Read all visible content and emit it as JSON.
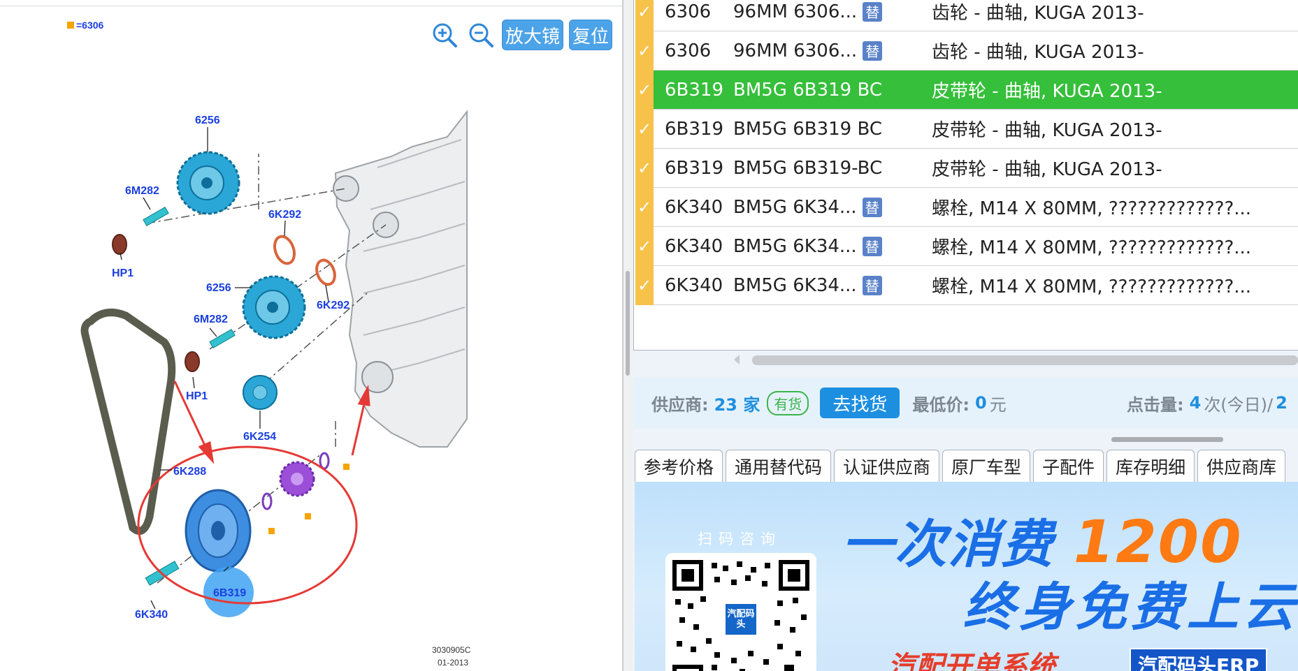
{
  "diagram": {
    "legend_text": "=6306",
    "toolbar": {
      "zoom_in_icon": "zoom-in-icon",
      "zoom_out_icon": "zoom-out-icon",
      "magnifier_label": "放大镜",
      "reset_label": "复位"
    },
    "labels": {
      "cam_gear_top": "6256",
      "bolt_top": "6M282",
      "seal_top": "6K292",
      "washer_top": "HP1",
      "cam_gear_mid": "6256",
      "seal_mid": "6K292",
      "bolt_mid": "6M282",
      "washer_mid": "HP1",
      "tensioner": "6K254",
      "belt": "6K288",
      "pulley": "6B319",
      "crank_bolt": "6K340"
    },
    "stamp_code": "3030905C",
    "stamp_date": "01-2013"
  },
  "parts_table": {
    "rows": [
      {
        "code": "6306",
        "part_no": "96MM 6306...",
        "substitute": "替",
        "desc": "齿轮 - 曲轴, KUGA 2013-",
        "selected": false
      },
      {
        "code": "6306",
        "part_no": "96MM 6306...",
        "substitute": "替",
        "desc": "齿轮 - 曲轴, KUGA 2013-",
        "selected": false
      },
      {
        "code": "6B319",
        "part_no": "BM5G 6B319 BC",
        "substitute": "",
        "desc": "皮带轮 - 曲轴, KUGA 2013-",
        "selected": true
      },
      {
        "code": "6B319",
        "part_no": "BM5G 6B319 BC",
        "substitute": "",
        "desc": "皮带轮 - 曲轴, KUGA 2013-",
        "selected": false
      },
      {
        "code": "6B319",
        "part_no": "BM5G 6B319-BC",
        "substitute": "",
        "desc": "皮带轮 - 曲轴, KUGA 2013-",
        "selected": false
      },
      {
        "code": "6K340",
        "part_no": "BM5G 6K34...",
        "substitute": "替",
        "desc": "螺栓, M14 X 80MM, ?????????????...",
        "selected": false
      },
      {
        "code": "6K340",
        "part_no": "BM5G 6K34...",
        "substitute": "替",
        "desc": "螺栓, M14 X 80MM, ?????????????...",
        "selected": false
      },
      {
        "code": "6K340",
        "part_no": "BM5G 6K34...",
        "substitute": "替",
        "desc": "螺栓, M14 X 80MM, ?????????????...",
        "selected": false
      }
    ]
  },
  "supplier_bar": {
    "supplier_label": "供应商:",
    "supplier_count": "23 家",
    "stock_badge": "有货",
    "find_button": "去找货",
    "min_price_label": "最低价:",
    "min_price_value": "0",
    "min_price_unit": "元",
    "clicks_label": "点击量:",
    "clicks_today": "4",
    "clicks_today_suffix": "次(今日)/",
    "clicks_total_partial": "2"
  },
  "tabs": [
    "参考价格",
    "通用替代码",
    "认证供应商",
    "原厂车型",
    "子配件",
    "库存明细",
    "供应商库"
  ],
  "banner": {
    "qr_title": "扫码咨询",
    "qr_center_text": "汽配码头",
    "line1_prefix": "一次消费",
    "line1_number": "1200",
    "line2": "终身免费上云",
    "line3": "汽配开单系统",
    "tag": "汽配码头ERP"
  },
  "colors": {
    "selected_row": "#35bf3a",
    "checkbox": "#f7c24a",
    "accent_blue": "#1d8fe0",
    "label_blue": "#1a3fe0",
    "callout_red": "#e53935"
  }
}
